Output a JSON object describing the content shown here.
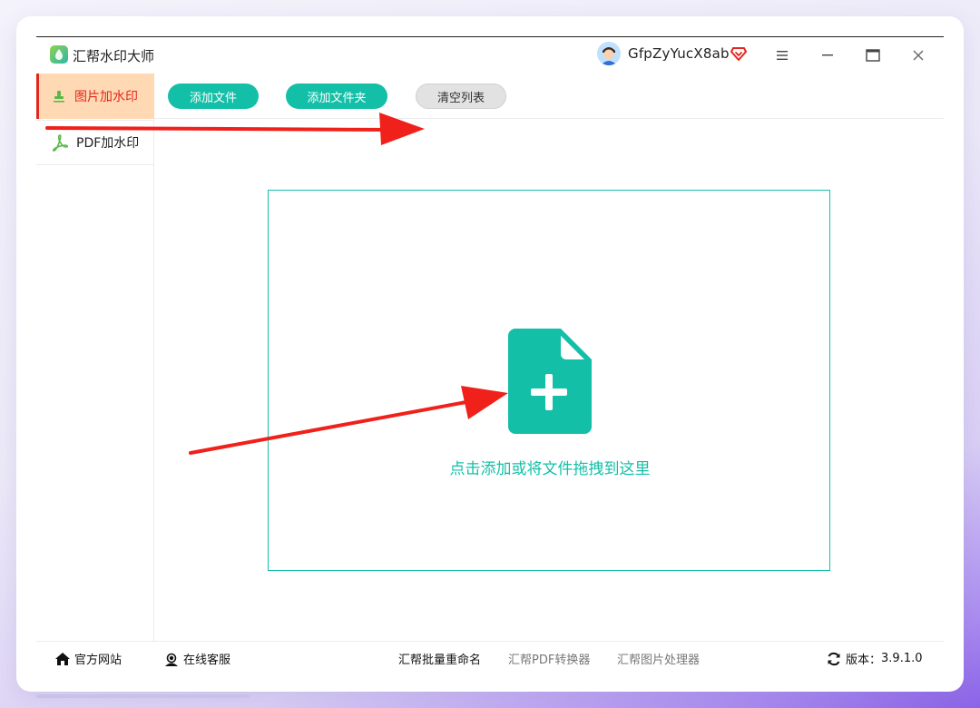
{
  "app": {
    "title": "汇帮水印大师",
    "username": "GfpZyYucX8ab"
  },
  "sidebar": {
    "items": [
      {
        "label": "图片加水印",
        "icon": "stamp-icon",
        "active": true
      },
      {
        "label": "PDF加水印",
        "icon": "pdf-icon",
        "active": false
      }
    ]
  },
  "toolbar": {
    "add_file": "添加文件",
    "add_folder": "添加文件夹",
    "clear_list": "清空列表"
  },
  "dropzone": {
    "hint": "点击添加或将文件拖拽到这里",
    "icon": "file-add-icon"
  },
  "footer": {
    "official_site": "官方网站",
    "online_service": "在线客服",
    "batch_rename": "汇帮批量重命名",
    "pdf_converter": "汇帮PDF转换器",
    "image_processor": "汇帮图片处理器",
    "version_label": "版本：",
    "version": "3.9.1.0"
  },
  "colors": {
    "accent": "#14bfa8",
    "active_bg": "#ffd9b3",
    "active_text": "#e3261b",
    "annotation_arrow": "#f0201a"
  }
}
